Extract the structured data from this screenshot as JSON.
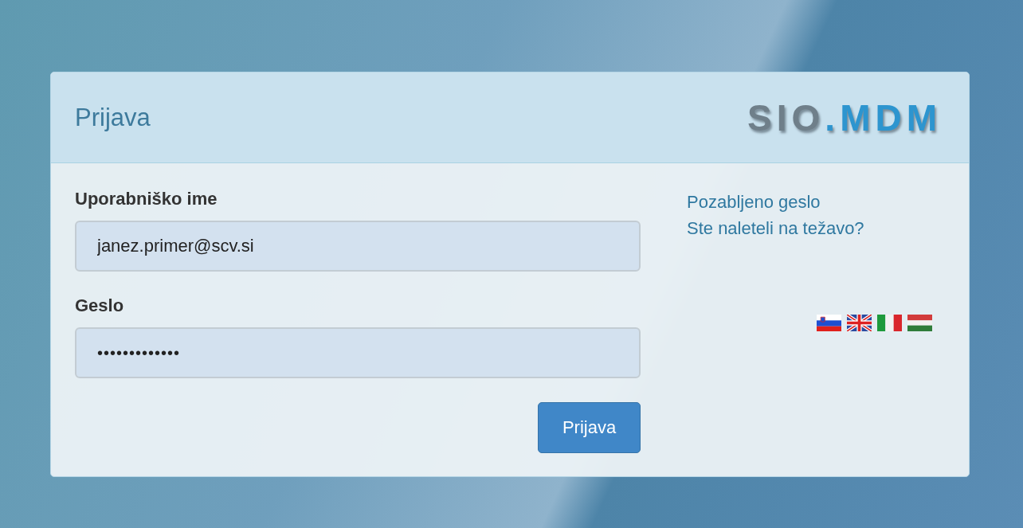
{
  "panel": {
    "title": "Prijava",
    "logo": [
      "SIO",
      ".MDM"
    ]
  },
  "fields": [
    {
      "label": "Uporabniško ime",
      "value": "janez.primer@scv.si",
      "kind": "text"
    },
    {
      "label": "Geslo",
      "value": "•••••••••••••",
      "kind": "password"
    }
  ],
  "submit": "Prijava",
  "links": [
    "Pozabljeno geslo",
    "Ste naleteli na težavo?"
  ],
  "languages": [
    {
      "kind": "si"
    },
    {
      "kind": "gb"
    },
    {
      "kind": "it"
    },
    {
      "kind": "hu"
    }
  ]
}
